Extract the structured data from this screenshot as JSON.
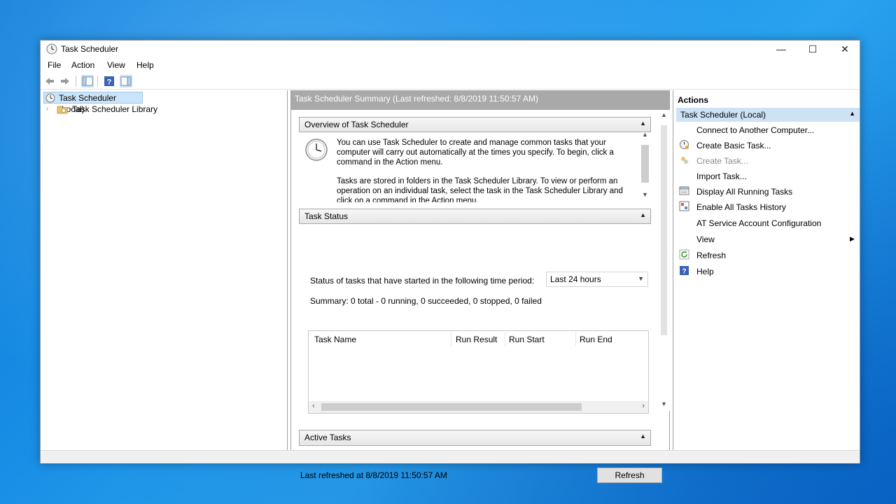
{
  "window": {
    "title": "Task Scheduler",
    "controls": {
      "minimize": "—",
      "maximize": "☐",
      "close": "✕"
    }
  },
  "menu": [
    "File",
    "Action",
    "View",
    "Help"
  ],
  "tree": {
    "root": "Task Scheduler (Local)",
    "child": "Task Scheduler Library"
  },
  "center": {
    "summary_header": "Task Scheduler Summary (Last refreshed: 8/8/2019 11:50:57 AM)",
    "overview": {
      "title": "Overview of Task Scheduler",
      "para1": "You can use Task Scheduler to create and manage common tasks that your computer will carry out automatically at the times you specify. To begin, click a command in the Action menu.",
      "para2": "Tasks are stored in folders in the Task Scheduler Library. To view or perform an operation on an individual task, select the task in the Task Scheduler Library and click on a command in the Action menu."
    },
    "task_status": {
      "title": "Task Status",
      "period_label": "Status of tasks that have started in the following time period:",
      "period_value": "Last 24 hours",
      "summary": "Summary: 0 total - 0 running, 0 succeeded, 0 stopped, 0 failed",
      "columns": [
        "Task Name",
        "Run Result",
        "Run Start",
        "Run End"
      ]
    },
    "active_tasks": {
      "title": "Active Tasks"
    },
    "last_refreshed": "Last refreshed at 8/8/2019 11:50:57 AM",
    "refresh_button": "Refresh"
  },
  "actions": {
    "title": "Actions",
    "group": "Task Scheduler (Local)",
    "items": [
      {
        "label": "Connect to Another Computer...",
        "icon": "none"
      },
      {
        "label": "Create Basic Task...",
        "icon": "create-basic-task-icon"
      },
      {
        "label": "Create Task...",
        "icon": "create-task-icon",
        "disabled": true
      },
      {
        "label": "Import Task...",
        "icon": "none"
      },
      {
        "label": "Display All Running Tasks",
        "icon": "running-tasks-icon"
      },
      {
        "label": "Enable All Tasks History",
        "icon": "history-icon"
      },
      {
        "label": "AT Service Account Configuration",
        "icon": "none"
      },
      {
        "label": "View",
        "icon": "none",
        "submenu": true
      },
      {
        "label": "Refresh",
        "icon": "refresh-icon"
      },
      {
        "label": "Help",
        "icon": "help-icon"
      }
    ]
  },
  "colors": {
    "desktop": "#1a8fe6",
    "selection": "#cce4f7",
    "summary_header_bg": "#a9a9a9"
  }
}
